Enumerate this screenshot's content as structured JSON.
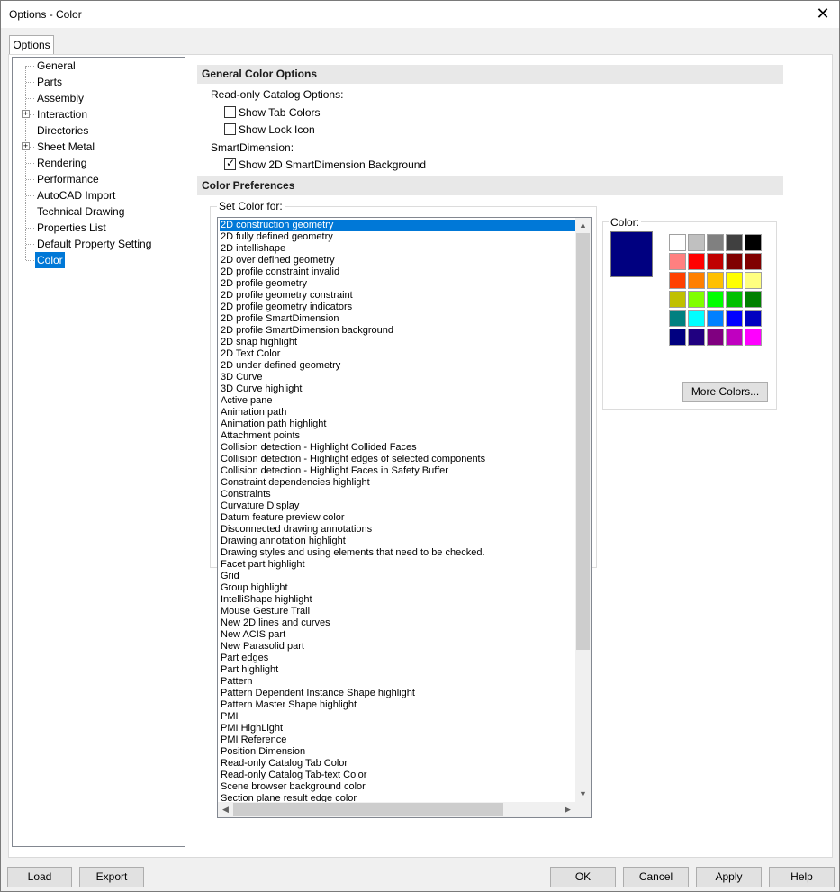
{
  "window": {
    "title": "Options - Color",
    "close_glyph": "✕"
  },
  "tab": {
    "label": "Options"
  },
  "tree": {
    "items": [
      {
        "label": "General",
        "expandable": false
      },
      {
        "label": "Parts",
        "expandable": false
      },
      {
        "label": "Assembly",
        "expandable": false
      },
      {
        "label": "Interaction",
        "expandable": true
      },
      {
        "label": "Directories",
        "expandable": false
      },
      {
        "label": "Sheet Metal",
        "expandable": true
      },
      {
        "label": "Rendering",
        "expandable": false
      },
      {
        "label": "Performance",
        "expandable": false
      },
      {
        "label": "AutoCAD Import",
        "expandable": false
      },
      {
        "label": "Technical Drawing",
        "expandable": false
      },
      {
        "label": "Properties List",
        "expandable": false
      },
      {
        "label": "Default Property Setting",
        "expandable": false
      },
      {
        "label": "Color",
        "expandable": false,
        "selected": true
      }
    ]
  },
  "general": {
    "header": "General Color Options",
    "readonly_label": "Read-only Catalog Options:",
    "show_tab_colors": {
      "label": "Show Tab Colors",
      "checked": false
    },
    "show_lock_icon": {
      "label": "Show Lock Icon",
      "checked": false
    },
    "smartdim_label": "SmartDimension:",
    "show_2d_bg": {
      "label": "Show 2D SmartDimension Background",
      "checked": true
    }
  },
  "prefs": {
    "header": "Color Preferences",
    "set_color_for": "Set Color for:",
    "color_label": "Color:",
    "current_color": "#000080",
    "more_colors": "More Colors...",
    "items": [
      "2D construction geometry",
      "2D fully defined geometry",
      "2D intellishape",
      "2D over defined geometry",
      "2D profile constraint invalid",
      "2D profile geometry",
      "2D profile geometry constraint",
      "2D profile geometry indicators",
      "2D profile SmartDimension",
      "2D profile SmartDimension background",
      "2D snap highlight",
      "2D Text Color",
      "2D under defined geometry",
      "3D Curve",
      "3D Curve highlight",
      "Active pane",
      "Animation path",
      "Animation path highlight",
      "Attachment points",
      "Collision detection - Highlight Collided Faces",
      "Collision detection - Highlight edges of selected components",
      "Collision detection - Highlight Faces in Safety Buffer",
      "Constraint dependencies highlight",
      "Constraints",
      "Curvature Display",
      "Datum feature preview color",
      "Disconnected drawing annotations",
      "Drawing annotation highlight",
      "Drawing styles and using elements that need to be checked.",
      "Facet part highlight",
      "Grid",
      "Group highlight",
      "IntelliShape highlight",
      "Mouse Gesture Trail",
      "New 2D lines and curves",
      "New ACIS part",
      "New Parasolid part",
      "Part edges",
      "Part highlight",
      "Pattern",
      "Pattern Dependent Instance Shape highlight",
      "Pattern Master Shape highlight",
      "PMI",
      "PMI HighLight",
      "PMI Reference",
      "Position Dimension",
      "Read-only Catalog Tab Color",
      "Read-only Catalog Tab-text Color",
      "Scene browser background color",
      "Section plane result edge color"
    ],
    "selected_index": 0,
    "palette": [
      "#ffffff",
      "#c0c0c0",
      "#808080",
      "#404040",
      "#000000",
      "#ff8080",
      "#ff0000",
      "#c00000",
      "#800000",
      "#800000",
      "#ff4000",
      "#ff8000",
      "#ffc000",
      "#ffff00",
      "#ffff80",
      "#c0c000",
      "#80ff00",
      "#00ff00",
      "#00c000",
      "#008000",
      "#008080",
      "#00ffff",
      "#0080ff",
      "#0000ff",
      "#0000c0",
      "#000080",
      "#200080",
      "#800080",
      "#c000c0",
      "#ff00ff"
    ]
  },
  "footer": {
    "load": "Load",
    "export": "Export",
    "ok": "OK",
    "cancel": "Cancel",
    "apply": "Apply",
    "help": "Help"
  }
}
